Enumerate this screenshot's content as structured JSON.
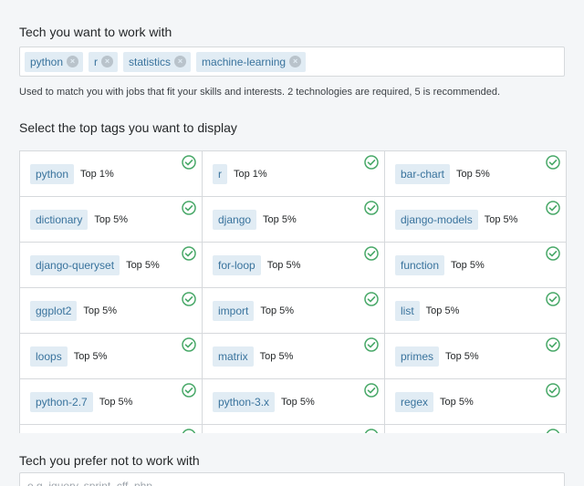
{
  "tech": {
    "title": "Tech you want to work with",
    "tags": [
      {
        "label": "python"
      },
      {
        "label": "r"
      },
      {
        "label": "statistics"
      },
      {
        "label": "machine-learning"
      }
    ],
    "remove_glyph": "×",
    "help": "Used to match you with jobs that fit your skills and interests. 2 technologies are required, 5 is recommended."
  },
  "top_tags": {
    "title": "Select the top tags you want to display",
    "check_icon": "check-circle-icon",
    "check_color": "#48a868",
    "cells": [
      {
        "tag": "python",
        "rank": "Top 1%",
        "selected": true
      },
      {
        "tag": "r",
        "rank": "Top 1%",
        "selected": true
      },
      {
        "tag": "bar-chart",
        "rank": "Top 5%",
        "selected": true
      },
      {
        "tag": "dictionary",
        "rank": "Top 5%",
        "selected": true
      },
      {
        "tag": "django",
        "rank": "Top 5%",
        "selected": true
      },
      {
        "tag": "django-models",
        "rank": "Top 5%",
        "selected": true
      },
      {
        "tag": "django-queryset",
        "rank": "Top 5%",
        "selected": true
      },
      {
        "tag": "for-loop",
        "rank": "Top 5%",
        "selected": true
      },
      {
        "tag": "function",
        "rank": "Top 5%",
        "selected": true
      },
      {
        "tag": "ggplot2",
        "rank": "Top 5%",
        "selected": true
      },
      {
        "tag": "import",
        "rank": "Top 5%",
        "selected": true
      },
      {
        "tag": "list",
        "rank": "Top 5%",
        "selected": true
      },
      {
        "tag": "loops",
        "rank": "Top 5%",
        "selected": true
      },
      {
        "tag": "matrix",
        "rank": "Top 5%",
        "selected": true
      },
      {
        "tag": "primes",
        "rank": "Top 5%",
        "selected": true
      },
      {
        "tag": "python-2.7",
        "rank": "Top 5%",
        "selected": true
      },
      {
        "tag": "python-3.x",
        "rank": "Top 5%",
        "selected": true
      },
      {
        "tag": "regex",
        "rank": "Top 5%",
        "selected": true
      },
      {
        "tag": "",
        "rank": "",
        "selected": true
      },
      {
        "tag": "",
        "rank": "",
        "selected": true
      },
      {
        "tag": "",
        "rank": "",
        "selected": true
      }
    ]
  },
  "avoid": {
    "title": "Tech you prefer not to work with",
    "placeholder": "e.g. jquery, sprint, cff, php"
  },
  "colors": {
    "tag_bg": "#e1ecf4",
    "tag_text": "#39739d",
    "border": "#d6d9dc",
    "page_bg": "#f4f6f8"
  }
}
